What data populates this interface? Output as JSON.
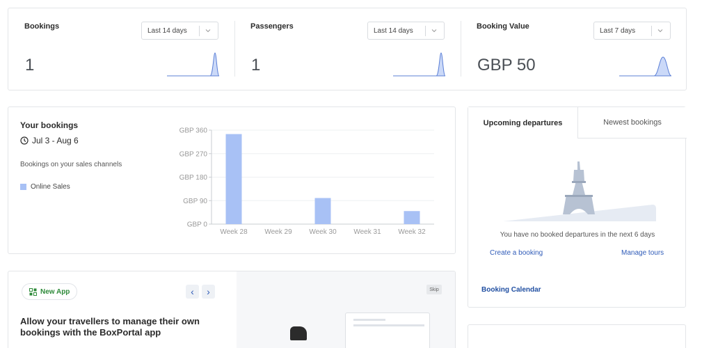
{
  "stats": [
    {
      "title": "Bookings",
      "value": "1",
      "range": "Last 14 days"
    },
    {
      "title": "Passengers",
      "value": "1",
      "range": "Last 14 days"
    },
    {
      "title": "Booking Value",
      "value": "GBP 50",
      "range": "Last 7 days"
    }
  ],
  "bookings_card": {
    "title": "Your bookings",
    "date_range": "Jul 3 - Aug 6",
    "subtitle": "Bookings on your sales channels",
    "legend": "Online Sales"
  },
  "chart_data": {
    "type": "bar",
    "categories": [
      "Week 28",
      "Week 29",
      "Week 30",
      "Week 31",
      "Week 32"
    ],
    "series": [
      {
        "name": "Online Sales",
        "values": [
          345,
          0,
          100,
          0,
          50
        ]
      }
    ],
    "y_ticks": [
      "GBP 0",
      "GBP 90",
      "GBP 180",
      "GBP 270",
      "GBP 360"
    ],
    "ylim": [
      0,
      360
    ],
    "grid": true,
    "colors": {
      "bar": "#a8c1f5"
    }
  },
  "departures": {
    "tabs": [
      "Upcoming departures",
      "Newest bookings"
    ],
    "empty_text": "You have no booked departures in the next 6 days",
    "create_link": "Create a booking",
    "manage_link": "Manage tours",
    "calendar_link": "Booking Calendar"
  },
  "newapp": {
    "badge": "New App",
    "headline": "Allow your travellers to manage their own bookings with the BoxPortal app",
    "skip": "Skip",
    "prev": "‹",
    "next": "›"
  },
  "colors": {
    "accent": "#2f5bb8",
    "bar": "#a8c1f5",
    "green": "#2e8a3a"
  }
}
